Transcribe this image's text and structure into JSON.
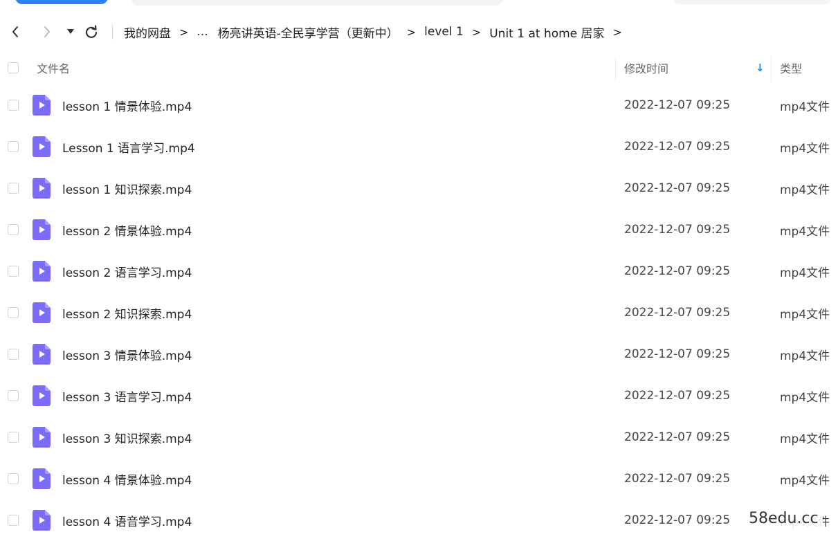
{
  "nav": {
    "breadcrumbs": [
      "我的网盘",
      "...",
      "杨亮讲英语-全民享学营（更新中）",
      "level 1",
      "Unit 1 at home 居家"
    ],
    "separator": ">"
  },
  "table": {
    "columns": {
      "name": "文件名",
      "modified": "修改时间",
      "type": "类型"
    },
    "sort_indicator": "↓",
    "rows": [
      {
        "name": "lesson 1 情景体验.mp4",
        "date": "2022-12-07 09:25",
        "type": "mp4文件"
      },
      {
        "name": "Lesson 1 语言学习.mp4",
        "date": "2022-12-07 09:25",
        "type": "mp4文件"
      },
      {
        "name": "lesson 1 知识探索.mp4",
        "date": "2022-12-07 09:25",
        "type": "mp4文件"
      },
      {
        "name": "lesson 2 情景体验.mp4",
        "date": "2022-12-07 09:25",
        "type": "mp4文件"
      },
      {
        "name": "lesson 2 语言学习.mp4",
        "date": "2022-12-07 09:25",
        "type": "mp4文件"
      },
      {
        "name": "lesson 2 知识探索.mp4",
        "date": "2022-12-07 09:25",
        "type": "mp4文件"
      },
      {
        "name": "lesson 3 情景体验.mp4",
        "date": "2022-12-07 09:25",
        "type": "mp4文件"
      },
      {
        "name": "lesson 3 语言学习.mp4",
        "date": "2022-12-07 09:25",
        "type": "mp4文件"
      },
      {
        "name": "lesson 3 知识探索.mp4",
        "date": "2022-12-07 09:25",
        "type": "mp4文件"
      },
      {
        "name": "lesson 4 情景体验.mp4",
        "date": "2022-12-07 09:25",
        "type": "mp4文件"
      },
      {
        "name": "lesson 4 语音学习.mp4",
        "date": "2022-12-07 09:25",
        "type": "mp4文件"
      }
    ]
  },
  "watermark": "58edu.cc",
  "colors": {
    "accent": "#2f80ff",
    "file_icon": "#7b6cf6",
    "sort_arrow": "#1e88e5"
  }
}
